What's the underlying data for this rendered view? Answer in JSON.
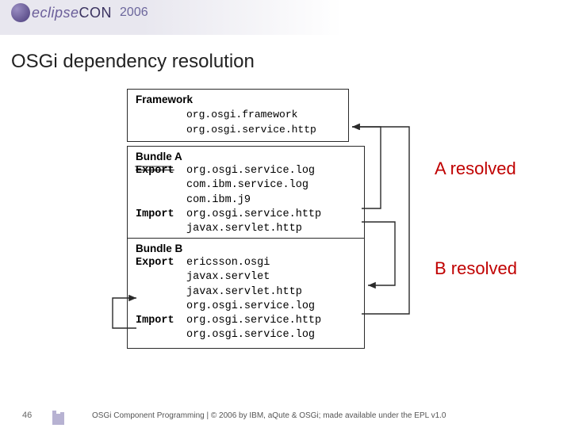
{
  "header": {
    "logo_text": "eclipse",
    "logo_suffix": "CON",
    "year": "2006"
  },
  "title": "OSGi dependency resolution",
  "framework": {
    "heading": "Framework",
    "packages": [
      "org.osgi.framework",
      "org.osgi.service.http"
    ]
  },
  "bundleA": {
    "heading": "Bundle A",
    "export_kw": "Export",
    "export_pkgs": [
      "org.osgi.service.log",
      "com.ibm.service.log",
      "com.ibm.j9"
    ],
    "import_kw": "Import",
    "import_pkgs": [
      "org.osgi.service.http",
      "javax.servlet.http"
    ]
  },
  "bundleB": {
    "heading": "Bundle B",
    "export_kw": "Export",
    "export_pkgs": [
      "ericsson.osgi",
      "javax.servlet",
      "javax.servlet.http",
      "org.osgi.service.log"
    ],
    "import_kw": "Import",
    "import_pkgs": [
      "org.osgi.service.http",
      "org.osgi.service.log"
    ]
  },
  "labels": {
    "a": "A resolved",
    "b": "B resolved"
  },
  "footer": {
    "page": "46",
    "text": "OSGi Component Programming | © 2006 by IBM, aQute & OSGi; made available under the EPL v1.0"
  }
}
